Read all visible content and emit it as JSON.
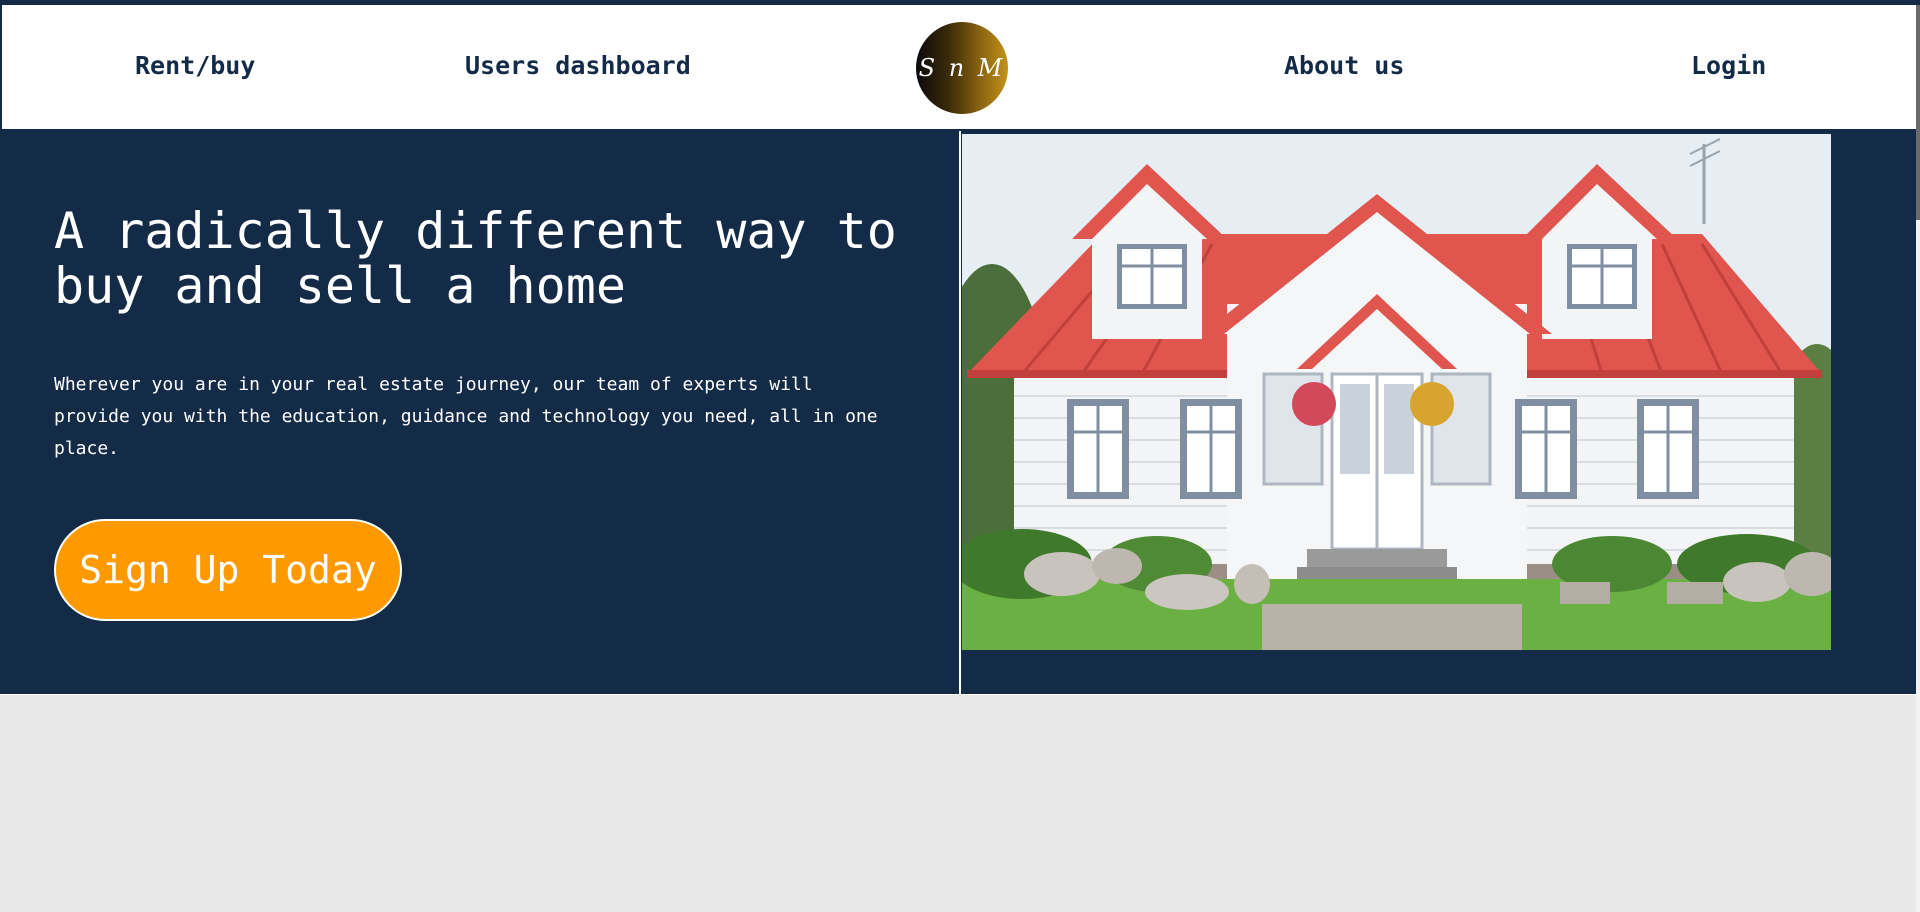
{
  "nav": {
    "links": [
      {
        "label": "Rent/buy"
      },
      {
        "label": "Users dashboard"
      },
      {
        "label": "About us"
      },
      {
        "label": "Login"
      }
    ],
    "logo_text": "S n M"
  },
  "hero": {
    "headline": "A radically different way to buy and sell a home",
    "subtext": "Wherever you are in your real estate journey, our team of experts will provide you with the education, guidance and technology you need, all in one place.",
    "cta_label": "Sign Up Today"
  },
  "colors": {
    "navy": "#142b48",
    "accent_orange": "#ff9900",
    "page_background": "#e8e8e8",
    "nav_text": "#142b48"
  }
}
